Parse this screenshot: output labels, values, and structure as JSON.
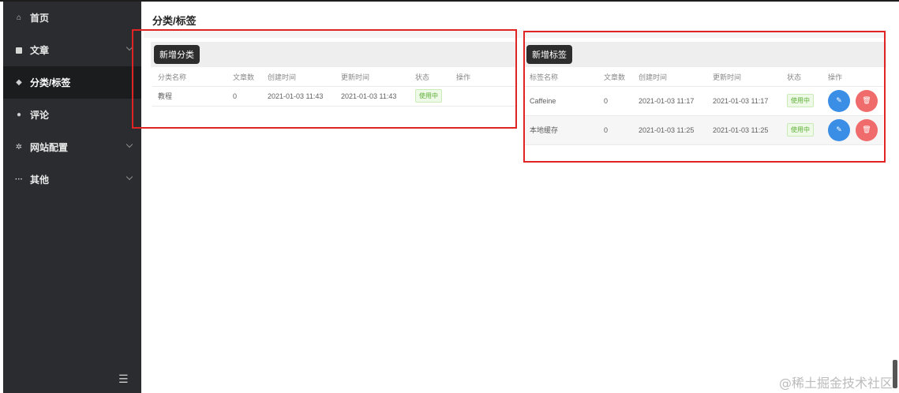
{
  "sidebar": {
    "items": [
      {
        "label": "首页",
        "icon": "home-icon",
        "glyph": "⌂",
        "active": false,
        "has_chevron": false
      },
      {
        "label": "文章",
        "icon": "document-icon",
        "glyph": "",
        "active": false,
        "has_chevron": true
      },
      {
        "label": "分类/标签",
        "icon": "tag-icon",
        "glyph": "◆",
        "active": true,
        "has_chevron": false
      },
      {
        "label": "评论",
        "icon": "comment-icon",
        "glyph": "●",
        "active": false,
        "has_chevron": false
      },
      {
        "label": "网站配置",
        "icon": "gear-icon",
        "glyph": "✲",
        "active": false,
        "has_chevron": true
      },
      {
        "label": "其他",
        "icon": "more-icon",
        "glyph": "···",
        "active": false,
        "has_chevron": true
      }
    ],
    "menu_toggle_glyph": "☰"
  },
  "header": {
    "title": "分类/标签"
  },
  "category_panel": {
    "add_button": "新增分类",
    "columns": [
      "分类名称",
      "文章数",
      "创建时间",
      "更新时间",
      "状态",
      "操作"
    ],
    "rows": [
      {
        "name": "教程",
        "count": "0",
        "created": "2021-01-03 11:43",
        "updated": "2021-01-03 11:43",
        "status": "使用中"
      }
    ]
  },
  "tag_panel": {
    "add_button": "新增标签",
    "columns": [
      "标签名称",
      "文章数",
      "创建时间",
      "更新时间",
      "状态",
      "操作"
    ],
    "rows": [
      {
        "name": "Caffeine",
        "count": "0",
        "created": "2021-01-03 11:17",
        "updated": "2021-01-03 11:17",
        "status": "使用中"
      },
      {
        "name": "本地缓存",
        "count": "0",
        "created": "2021-01-03 11:25",
        "updated": "2021-01-03 11:25",
        "status": "使用中"
      }
    ]
  },
  "icons": {
    "edit_glyph": "✎",
    "delete_glyph": "🗑"
  },
  "colors": {
    "sidebar_bg": "#2b2c2f",
    "active_bg": "#1b1c1e",
    "edit": "#3a8ee6",
    "delete": "#f06b6b",
    "status_green": "#5daf34",
    "annotation_red": "#e02424"
  },
  "watermark": "@稀土掘金技术社区"
}
